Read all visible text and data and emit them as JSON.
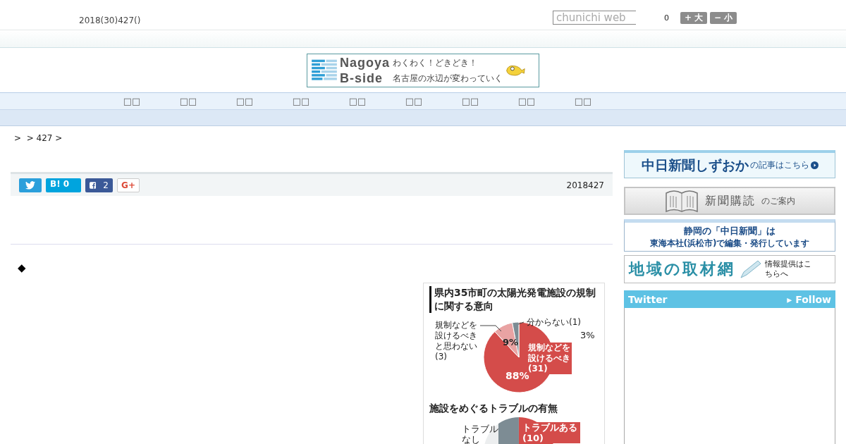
{
  "header": {
    "date": "2018(30)427()",
    "search": {
      "placeholder": "chunichi web"
    },
    "counter": "0",
    "font_buttons": [
      "+ 大",
      "− 小"
    ]
  },
  "banner": {
    "title_lines": [
      "Nagoya",
      "B-side"
    ],
    "tagline_lines": [
      "わくわく！どきどき！",
      "名古屋の水辺が変わっていく"
    ]
  },
  "nav": {
    "items": [
      "□□",
      "□□",
      "□□",
      "□□",
      "□□",
      "□□",
      "□□",
      "□□",
      "□□"
    ]
  },
  "breadcrumb": ">  > 427 >",
  "share": {
    "buttons": [
      {
        "kind": "twitter"
      },
      {
        "kind": "hatena",
        "label": "B!",
        "count": "0"
      },
      {
        "kind": "facebook",
        "count": "2"
      },
      {
        "kind": "google",
        "label": "G+"
      }
    ],
    "date": "2018427"
  },
  "article": {
    "marker": "◆",
    "figure": {
      "title": "県内35市町の太陽光発電施設の規制に関する意向",
      "chart_data": {
        "type": "pie",
        "categories": [
          "規制などを設けるべき(31)",
          "規制などを設けるべきと思わない(3)",
          "分からない(1)"
        ],
        "values": [
          88,
          9,
          3
        ],
        "colors": [
          "#d44c4a",
          "#e9a3a3",
          "#7d8c94"
        ],
        "value_labels": [
          "88%",
          "9%",
          "3%"
        ]
      },
      "second_title": "施設をめぐるトラブルの有無",
      "second_labels": [
        "トラブルなし",
        "トラブルある(10)"
      ]
    }
  },
  "sidebar": {
    "shizuoka": {
      "title": "中日新聞しずおか",
      "suffix": "の記事はこちら"
    },
    "subscribe": {
      "title": "新聞購読",
      "suffix": "のご案内"
    },
    "tokai": {
      "lines": [
        "静岡の「中日新聞」は",
        "東海本社(浜松市)で編集・発行しています"
      ]
    },
    "network": {
      "title": "地域の取材網",
      "note": "情報提供はこちらへ"
    },
    "twitter": {
      "title": "Twitter",
      "follow": "▸ Follow"
    }
  }
}
